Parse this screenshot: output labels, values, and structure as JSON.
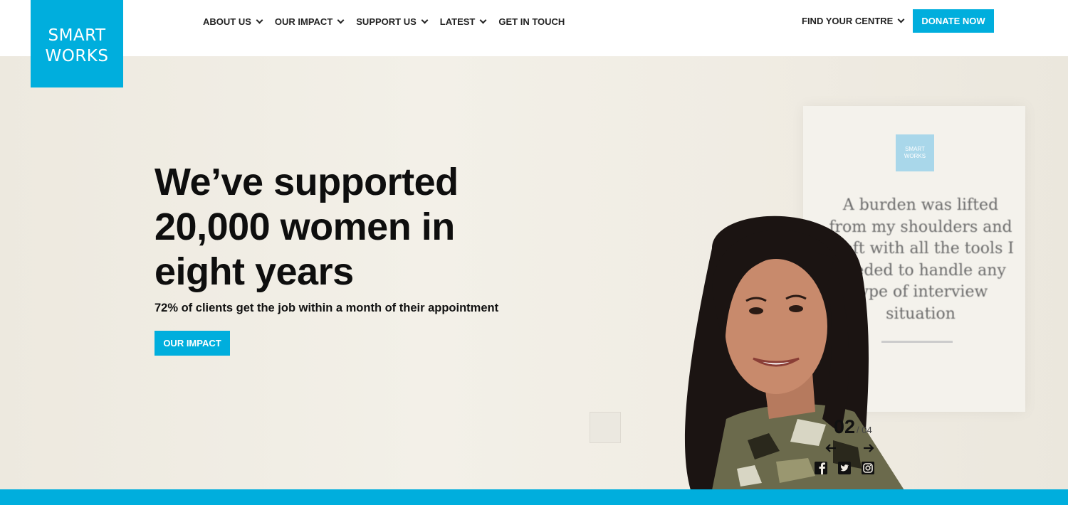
{
  "brand": {
    "logo_line1": "SMART",
    "logo_line2": "WORKS",
    "accent": "#00aedd"
  },
  "nav": {
    "items": [
      {
        "label": "ABOUT US",
        "has_dropdown": true
      },
      {
        "label": "OUR IMPACT",
        "has_dropdown": true
      },
      {
        "label": "SUPPORT US",
        "has_dropdown": true
      },
      {
        "label": "LATEST",
        "has_dropdown": true
      },
      {
        "label": "GET IN TOUCH",
        "has_dropdown": false
      }
    ],
    "find_centre": "FIND YOUR CENTRE",
    "donate": "DONATE NOW"
  },
  "hero": {
    "title_line1": "We’ve supported",
    "title_line2": "20,000 women in",
    "title_line3": "eight years",
    "subtitle": "72% of clients get the job within a month of their appointment",
    "cta": "OUR IMPACT",
    "poster_logo_line1": "SMART",
    "poster_logo_line2": "WORKS",
    "poster_quote": "A burden was lifted from my shoulders and I left with all the tools I needed to handle any type of interview situation"
  },
  "slider": {
    "current": "02",
    "total": "/ 04",
    "prev_icon": "arrow-left-icon",
    "next_icon": "arrow-right-icon"
  },
  "social": [
    "facebook-icon",
    "twitter-icon",
    "instagram-icon"
  ]
}
